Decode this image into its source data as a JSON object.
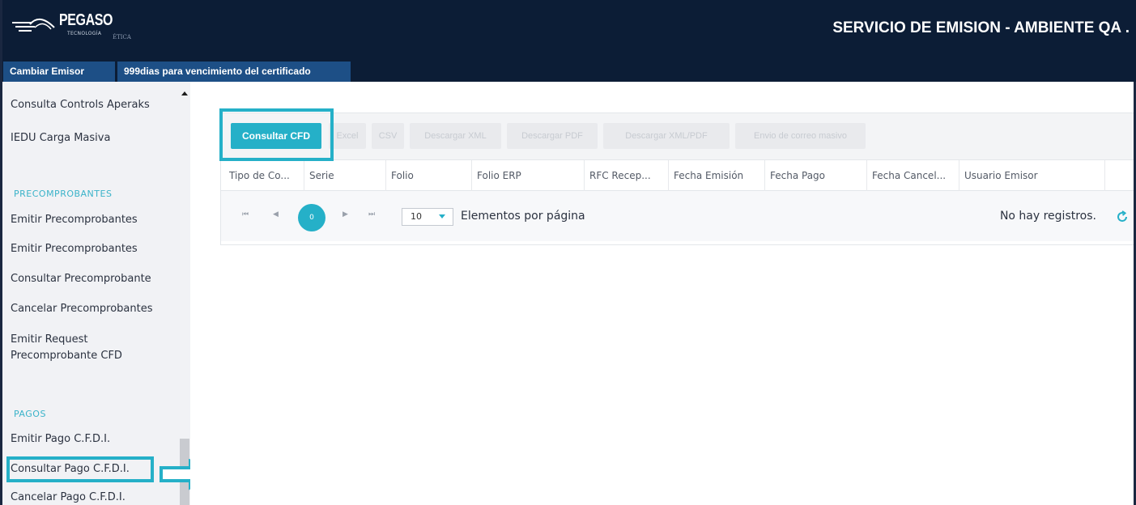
{
  "header": {
    "logo_name": "PEGASO",
    "logo_sub": "TECNOLOGÍA",
    "logo_sub2": "ÉTICA",
    "title": "SERVICIO DE EMISION - AMBIENTE QA ."
  },
  "tabs": [
    {
      "label": "Cambiar Emisor"
    },
    {
      "label": "999dias para vencimiento del certificado"
    }
  ],
  "sidebar": {
    "items_top": [
      {
        "label": "Consulta Controls Aperaks"
      },
      {
        "label": "IEDU Carga Masiva"
      }
    ],
    "section_precomprobantes": {
      "title": "PRECOMPROBANTES",
      "items": [
        {
          "label": "Emitir Precomprobantes"
        },
        {
          "label": "Emitir Precomprobantes"
        },
        {
          "label": "Consultar Precomprobante"
        },
        {
          "label": "Cancelar Precomprobantes"
        },
        {
          "label": "Emitir Request"
        },
        {
          "label": "Precomprobante CFD"
        }
      ]
    },
    "section_pagos": {
      "title": "PAGOS",
      "items": [
        {
          "label": "Emitir Pago C.F.D.I."
        },
        {
          "label": "Consultar Pago C.F.D.I."
        },
        {
          "label": "Cancelar Pago C.F.D.I."
        }
      ]
    }
  },
  "toolbar": {
    "buttons": [
      {
        "label": "Consultar CFD"
      },
      {
        "label": "Excel"
      },
      {
        "label": "CSV"
      },
      {
        "label": "Descargar XML"
      },
      {
        "label": "Descargar PDF"
      },
      {
        "label": "Descargar XML/PDF"
      },
      {
        "label": "Envio de correo masivo"
      }
    ]
  },
  "table": {
    "columns": [
      "Tipo de Co...",
      "Serie",
      "Folio",
      "Folio ERP",
      "RFC Recep...",
      "Fecha Emisión",
      "Fecha Pago",
      "Fecha Cancel...",
      "Usuario Emisor"
    ]
  },
  "pager": {
    "first": "⏮",
    "prev": "◀",
    "current_page": "0",
    "next": "▶",
    "last": "⏭",
    "page_size": "10",
    "page_size_label": "Elementos por página",
    "info": "No hay registros."
  },
  "colors": {
    "header_bg": "#0c1d36",
    "tab_bg": "#1d4f86",
    "accent": "#25b0c8",
    "section_title": "#3ab3c9"
  }
}
